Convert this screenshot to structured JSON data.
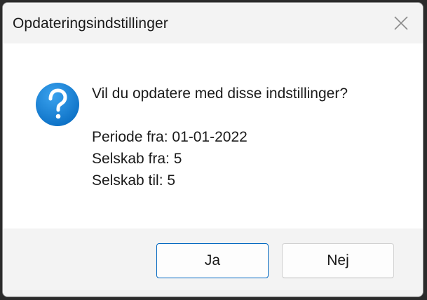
{
  "dialog": {
    "title": "Opdateringsindstillinger",
    "close_icon": "close-icon",
    "question_icon": "question-icon",
    "question": "Vil du opdatere med disse indstillinger?",
    "details": [
      "Periode fra: 01-01-2022",
      "Selskab fra: 5",
      "Selskab til: 5"
    ],
    "buttons": {
      "yes_label": "Ja",
      "no_label": "Nej"
    },
    "colors": {
      "accent": "#0067c0",
      "icon_blue": "#1a86d9"
    }
  }
}
